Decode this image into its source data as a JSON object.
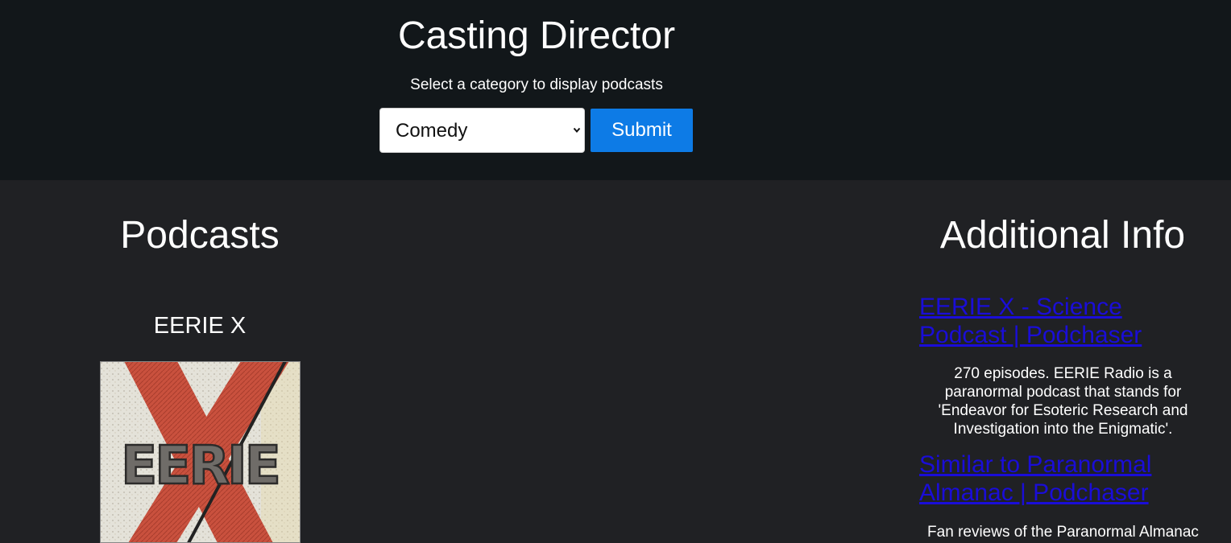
{
  "header": {
    "title": "Casting Director",
    "subtitle": "Select a category to display podcasts",
    "category_select": {
      "selected": "Comedy"
    },
    "submit_label": "Submit"
  },
  "podcasts": {
    "heading": "Podcasts",
    "items": [
      {
        "name": "EERIE X",
        "cover_text": "EERIE"
      }
    ]
  },
  "additional_info": {
    "heading": "Additional Info",
    "results": [
      {
        "title": "EERIE X - Science Podcast | Podchaser",
        "description": "270 episodes. EERIE Radio is a paranormal podcast that stands for 'Endeavor for Esoteric Research and Investigation into the Enigmatic'."
      },
      {
        "title": "Similar to Paranormal Almanac | Podchaser",
        "description": "Fan reviews of the Paranormal Almanac"
      }
    ]
  },
  "colors": {
    "header_bg": "#12171a",
    "page_bg": "#202124",
    "button": "#0d7be6",
    "link": "#1a0dd8"
  }
}
